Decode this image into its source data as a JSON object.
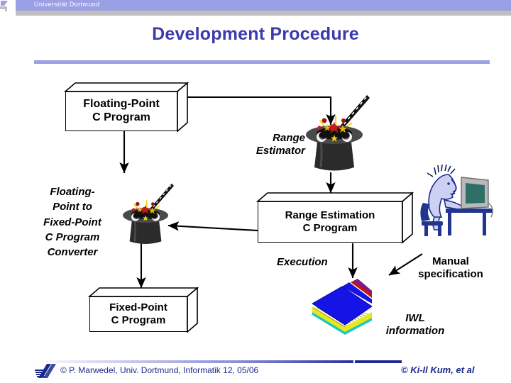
{
  "header": {
    "university": "Universität Dortmund",
    "band_color": "#9b9fe3"
  },
  "title": {
    "text": "Development Procedure",
    "color": "#3b3bab",
    "rule_color": "#9b9fe3"
  },
  "diagram": {
    "boxes": [
      {
        "id": "floating-point-c-program",
        "line1": "Floating-Point",
        "line2": "C Program"
      },
      {
        "id": "range-estimation-c-program",
        "line1": "Range Estimation",
        "line2": "C Program"
      },
      {
        "id": "fixed-point-c-program",
        "line1": "Fixed-Point",
        "line2": "C Program"
      }
    ],
    "labels": {
      "range_estimator_line1": "Range",
      "range_estimator_line2": "Estimator",
      "converter_line1": "Floating-",
      "converter_line2": "Point to",
      "converter_line3": "Fixed-Point",
      "converter_line4": "C Program",
      "converter_line5": "Converter",
      "execution": "Execution",
      "manual_line1": "Manual",
      "manual_line2": "specification",
      "iwl_line1": "IWL",
      "iwl_line2": "information"
    },
    "icons": {
      "magic_hat_top": "magic-hat-icon",
      "magic_hat_left": "magic-hat-icon",
      "person_at_computer": "person-at-computer-icon",
      "book": "book-icon"
    }
  },
  "footer": {
    "left": "© P. Marwedel, Univ. Dortmund, Informatik 12, 05/06",
    "right": "© Ki-Il Kum, et al",
    "color": "#1b2a8c"
  }
}
